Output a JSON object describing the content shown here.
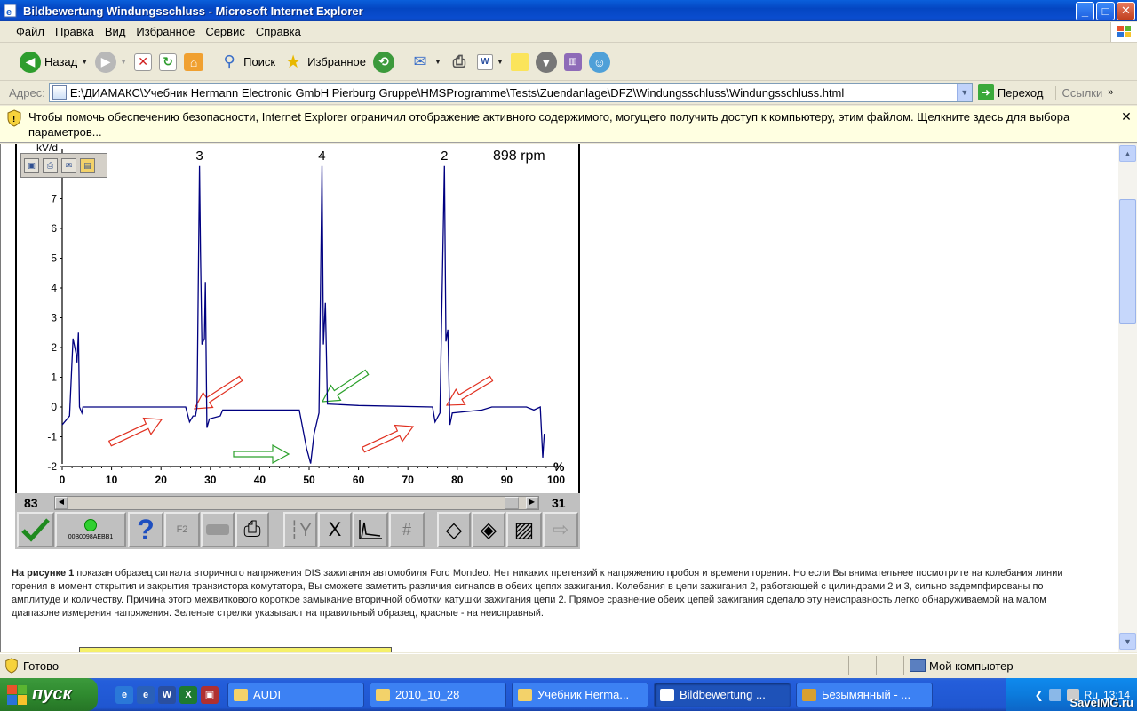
{
  "window": {
    "title": "Bildbewertung Windungsschluss - Microsoft Internet Explorer"
  },
  "menu": [
    "Файл",
    "Правка",
    "Вид",
    "Избранное",
    "Сервис",
    "Справка"
  ],
  "toolbar": {
    "back_label": "Назад",
    "search_label": "Поиск",
    "favorites_label": "Избранное"
  },
  "address": {
    "label": "Адрес:",
    "url": "E:\\ДИАМАКС\\Учебник Hermann Electronic GmbH Pierburg Gruppe\\HMSProgramme\\Tests\\Zuendanlage\\DFZ\\Windungsschluss\\Windungsschluss.html",
    "go_label": "Переход",
    "links_label": "Ссылки"
  },
  "infobar": {
    "text": "Чтобы помочь обеспечению безопасности, Internet Explorer ограничил отображение активного содержимого, могущего получить доступ к компьютеру, этим файлом. Щелкните здесь для выбора параметров..."
  },
  "scope": {
    "rpm": "898 rpm",
    "y_unit": "kV/d",
    "x_unit": "%",
    "cyl_labels": [
      "3",
      "4",
      "2"
    ],
    "left_num": "83",
    "right_num": "31",
    "led_code": "00B0098AEBB1",
    "f2_label": "F2"
  },
  "chart_data": {
    "type": "line",
    "title": "",
    "xlabel": "%",
    "ylabel": "kV/d",
    "xlim": [
      0,
      100
    ],
    "ylim": [
      -2,
      8
    ],
    "xticks": [
      0,
      10,
      20,
      30,
      40,
      50,
      60,
      70,
      80,
      90,
      100
    ],
    "yticks": [
      -2,
      -1,
      0,
      1,
      2,
      3,
      4,
      5,
      6,
      7
    ],
    "grid": false,
    "annotations": [
      "3",
      "4",
      "2",
      "898 rpm"
    ],
    "series": [
      {
        "values": [
          [
            0,
            -0.6
          ],
          [
            1.5,
            -0.3
          ],
          [
            2.2,
            2.3
          ],
          [
            2.8,
            1.8
          ],
          [
            3.0,
            1.5
          ],
          [
            3.3,
            2.5
          ],
          [
            3.5,
            0.0
          ],
          [
            4,
            -0.2
          ],
          [
            4.2,
            0.0
          ],
          [
            25,
            0.0
          ],
          [
            25.8,
            -0.5
          ],
          [
            26.5,
            -0.3
          ],
          [
            27,
            -0.3
          ],
          [
            27.3,
            0.0
          ],
          [
            27.8,
            8.1
          ],
          [
            28.0,
            5.2
          ],
          [
            28.3,
            2.1
          ],
          [
            28.8,
            2.3
          ],
          [
            29,
            4.2
          ],
          [
            29.3,
            -0.7
          ],
          [
            29.8,
            -0.4
          ],
          [
            32,
            -0.3
          ],
          [
            32.5,
            -0.1
          ],
          [
            48,
            -0.1
          ],
          [
            49.5,
            -1.4
          ],
          [
            50.3,
            -1.9
          ],
          [
            51,
            -0.9
          ],
          [
            52,
            -0.2
          ],
          [
            52.6,
            8.1
          ],
          [
            52.9,
            2.1
          ],
          [
            53.3,
            3.5
          ],
          [
            53.7,
            0.1
          ],
          [
            60,
            0.05
          ],
          [
            75,
            0.0
          ],
          [
            75.5,
            -0.5
          ],
          [
            76.5,
            -0.2
          ],
          [
            77.4,
            8.1
          ],
          [
            77.7,
            2.2
          ],
          [
            78.1,
            2.6
          ],
          [
            78.5,
            -0.6
          ],
          [
            79,
            -0.2
          ],
          [
            85,
            -0.1
          ],
          [
            87,
            0.0
          ],
          [
            94,
            0.0
          ],
          [
            95.5,
            -0.1
          ],
          [
            96.8,
            0.0
          ],
          [
            97.3,
            -1.7
          ],
          [
            97.6,
            -0.9
          ]
        ]
      }
    ]
  },
  "description": {
    "lead": "На рисунке 1",
    "text": " показан образец сигнала вторичного напряжения DIS зажигания автомобиля Ford Mondeo. Нет никаких претензий к напряжению пробоя и времени горения. Но если Вы внимательнее посмотрите на колебания линии горения в момент открытия и закрытия транзистора комутатора, Вы сможете заметить различия сигнапов в обеих цепях зажигания. Колебания в цепи зажигания 2, работающей с цилиндрами 2 и 3, сильно задемпфированы по амплитуде и количеству. Причина этого межвиткового короткое замыкание вторичной обмотки катушки зажигания цепи 2. Прямое сравнение обеих цепей зажигания сделало эту неисправность легко обнаруживаемой на малом диапазоне измерения напряжения. Зеленые стрелки указывают на правильный образец, красные - на неисправный."
  },
  "status": {
    "text": "Готово",
    "zone": "Мой компьютер"
  },
  "taskbar": {
    "start_label": "пуск",
    "tasks": [
      "AUDI",
      "2010_10_28",
      "Учебник Herma...",
      "Bildbewertung ...",
      "Безымянный - ..."
    ],
    "lang": "Ru",
    "clock": "13:14",
    "watermark": "SaveIMG.ru"
  },
  "colors": {
    "trace": "#000080",
    "green_arrow": "#2BA02B",
    "red_arrow": "#E03020"
  }
}
